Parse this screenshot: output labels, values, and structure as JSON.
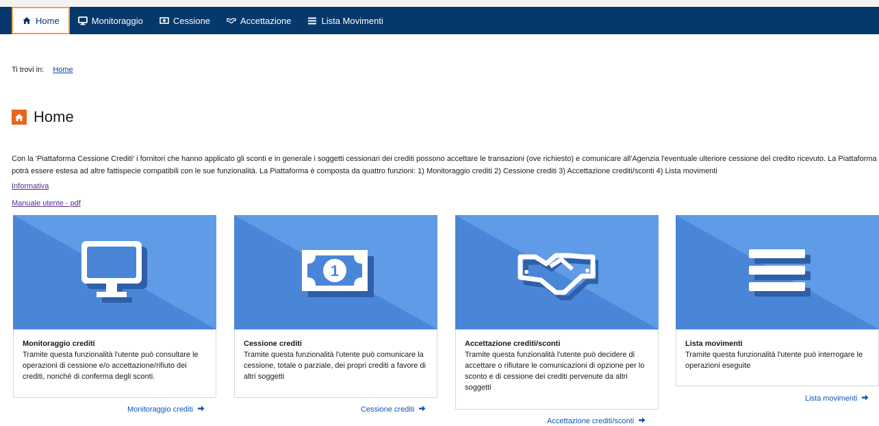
{
  "nav": {
    "items": [
      {
        "label": "Home",
        "icon": "home-icon"
      },
      {
        "label": "Monitoraggio",
        "icon": "monitor-icon"
      },
      {
        "label": "Cessione",
        "icon": "money-icon"
      },
      {
        "label": "Accettazione",
        "icon": "handshake-icon"
      },
      {
        "label": "Lista Movimenti",
        "icon": "list-icon"
      }
    ]
  },
  "breadcrumb": {
    "prefix": "Ti trovi in:",
    "current": "Home"
  },
  "page": {
    "title": "Home",
    "description": "Con la 'Piattaforma Cessione Crediti' i fornitori che hanno applicato gli sconti e in generale i soggetti cessionari dei crediti possono accettare le transazioni (ove richiesto) e comunicare all'Agenzia l'eventuale ulteriore cessione del credito ricevuto. La Piattaforma potrà essere estesa ad altre fattispecie compatibili con le sue funzionalità. La Piattaforma è composta da quattro funzioni: 1) Monitoraggio crediti 2) Cessione crediti 3) Accettazione crediti/sconti 4) Lista movimenti",
    "links": {
      "informativa": "Informativa",
      "manuale": "Manuale utente - pdf"
    }
  },
  "cards": [
    {
      "title": "Monitoraggio crediti",
      "text": "Tramite questa funzionalità l'utente può consultare le operazioni di cessione e/o accettazione/rifiuto dei crediti, nonché di conferma degli sconti.",
      "link": "Monitoraggio crediti",
      "icon": "monitor-icon"
    },
    {
      "title": "Cessione crediti",
      "text": "Tramite questa funzionalità l'utente può comunicare la cessione, totale o parziale, dei propri crediti a favore di altri soggetti",
      "link": "Cessione crediti",
      "icon": "money-icon"
    },
    {
      "title": "Accettazione crediti/sconti",
      "text": "Tramite questa funzionalità l'utente può decidere di accettare o rifiutare le comunicazioni di opzione per lo sconto e di cessione dei crediti pervenute da altri soggetti",
      "link": "Accettazione crediti/sconti",
      "icon": "handshake-icon"
    },
    {
      "title": "Lista movimenti",
      "text": "Tramite questa funzionalità l'utente può interrogare le operazioni eseguite",
      "link": "Lista movimenti",
      "icon": "list-icon"
    }
  ],
  "colors": {
    "navbar": "#06386b",
    "accent": "#e8651e",
    "card_blue": "#4a86d8",
    "link": "#0b57b8",
    "active_border": "#f0a14a"
  }
}
